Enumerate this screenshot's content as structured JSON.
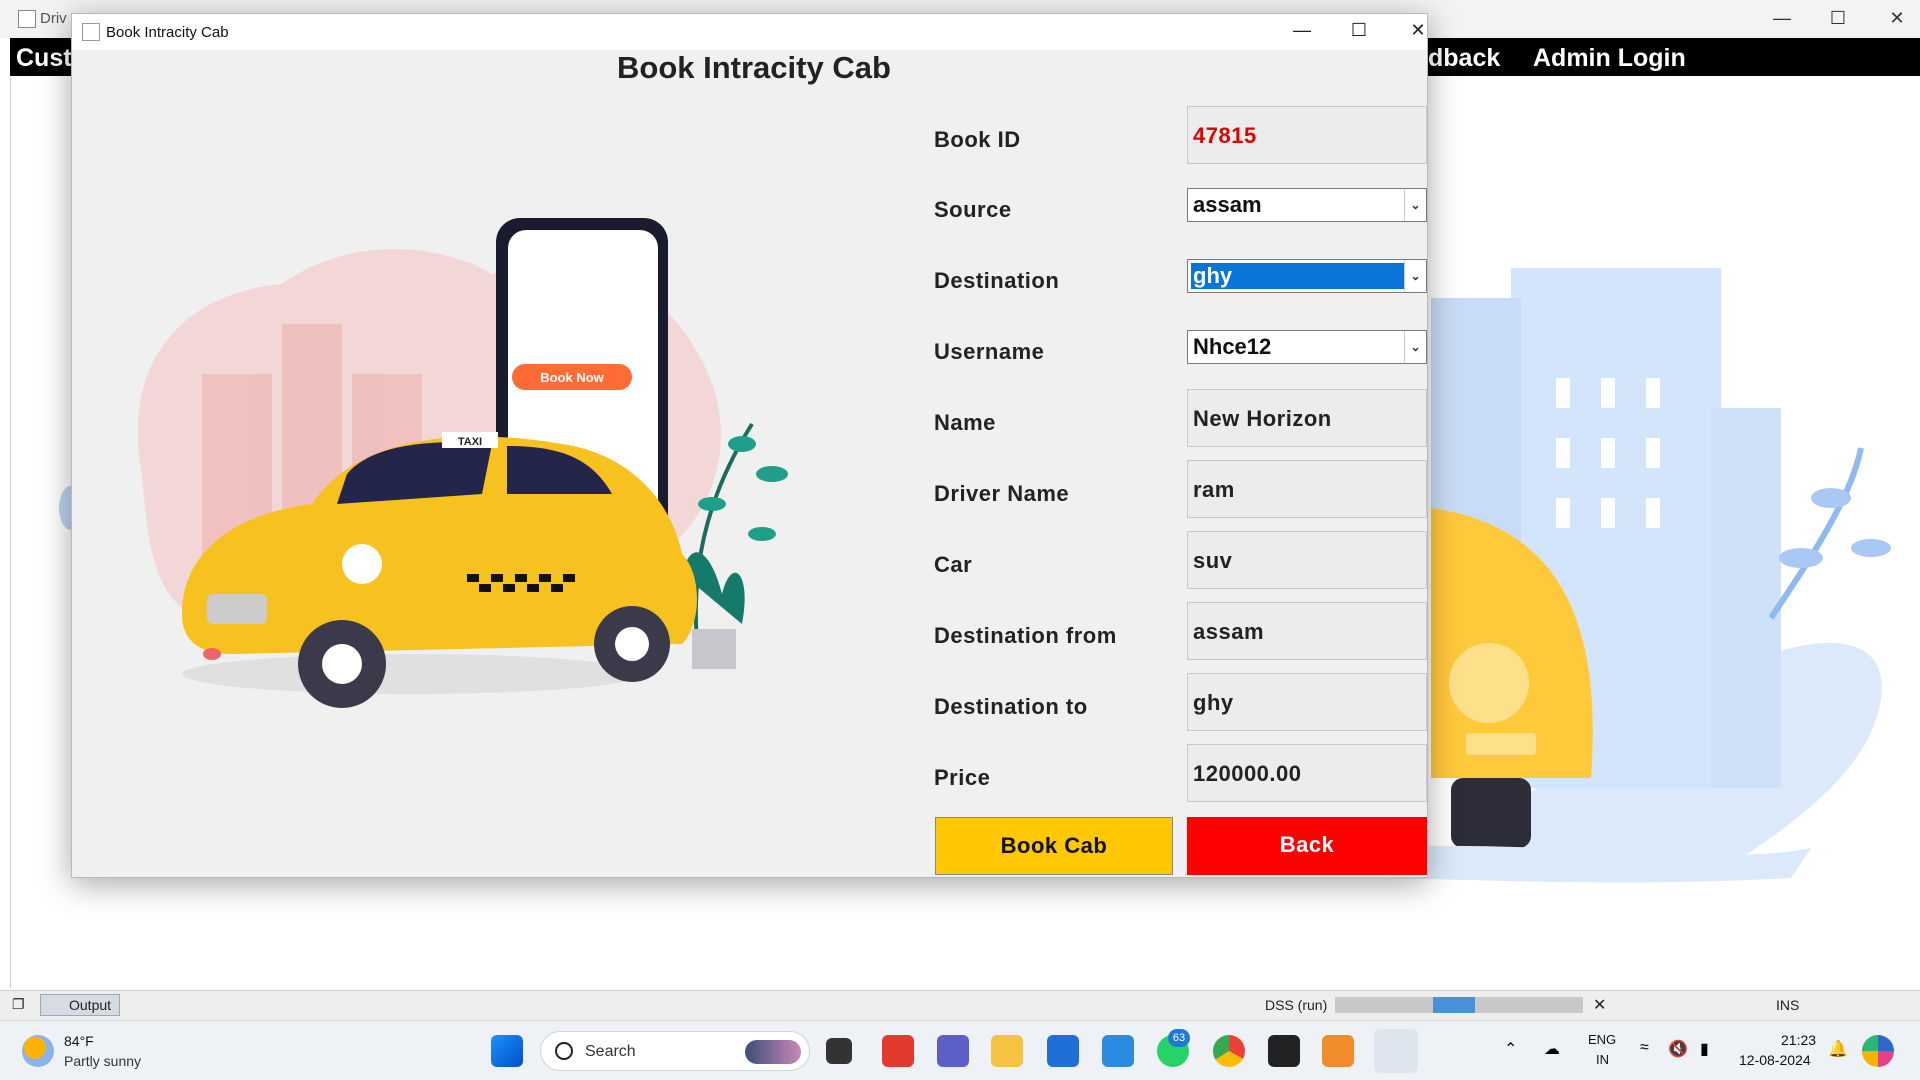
{
  "background_window": {
    "title": "Driv",
    "menu": [
      "Cust",
      "dback",
      "Admin Login"
    ]
  },
  "dialog": {
    "title": "Book Intracity Cab",
    "heading": "Book Intracity Cab",
    "illustration_button": "Book Now",
    "taxi_sign": "TAXI",
    "fields": [
      {
        "label": "Book ID",
        "value": "47815",
        "kind": "text",
        "color": "#e00000"
      },
      {
        "label": "Source",
        "value": "assam",
        "kind": "combo"
      },
      {
        "label": "Destination",
        "value": "ghy",
        "kind": "combo-selected"
      },
      {
        "label": "Username",
        "value": "Nhce12",
        "kind": "combo"
      },
      {
        "label": "Name",
        "value": "New Horizon",
        "kind": "text"
      },
      {
        "label": "Driver Name",
        "value": "ram",
        "kind": "text"
      },
      {
        "label": "Car",
        "value": "suv",
        "kind": "text"
      },
      {
        "label": "Destination from",
        "value": "assam",
        "kind": "text"
      },
      {
        "label": "Destination to",
        "value": "ghy",
        "kind": "text"
      },
      {
        "label": "Price",
        "value": "120000.00",
        "kind": "text"
      }
    ],
    "buttons": {
      "book": {
        "label": "Book Cab",
        "color": "#ffc800"
      },
      "back": {
        "label": "Back",
        "color": "#ff0000"
      }
    }
  },
  "ide_status": {
    "output_tab": "Output",
    "run_label": "DSS (run)",
    "progress": 0.4,
    "mode": "INS"
  },
  "taskbar": {
    "weather_temp": "84°F",
    "weather_desc": "Partly sunny",
    "search_placeholder": "Search",
    "whatsapp_badge": "63",
    "lang_line1": "ENG",
    "lang_line2": "IN",
    "time": "21:23",
    "date": "12-08-2024"
  }
}
